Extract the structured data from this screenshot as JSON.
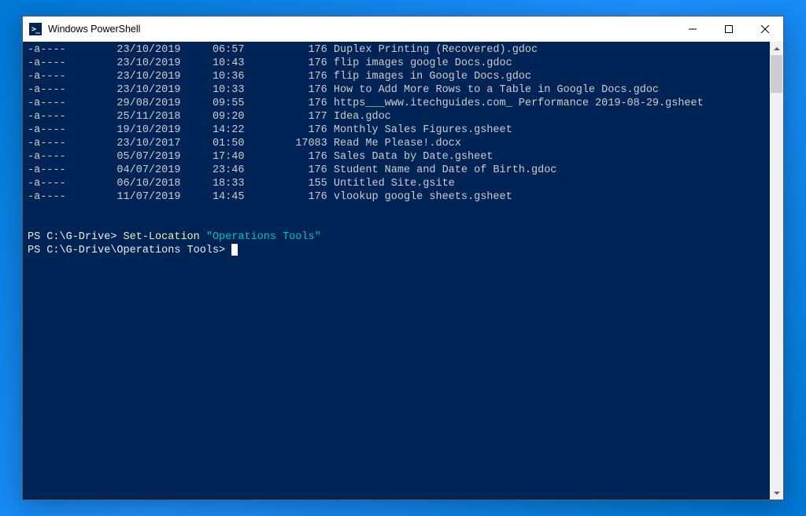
{
  "window": {
    "title": "Windows PowerShell"
  },
  "listing": {
    "rows": [
      {
        "mode": "-a----",
        "date": "23/10/2019",
        "time": "06:57",
        "length": "176",
        "name": "Duplex Printing (Recovered).gdoc"
      },
      {
        "mode": "-a----",
        "date": "23/10/2019",
        "time": "10:43",
        "length": "176",
        "name": "flip images google Docs.gdoc"
      },
      {
        "mode": "-a----",
        "date": "23/10/2019",
        "time": "10:36",
        "length": "176",
        "name": "flip images in Google Docs.gdoc"
      },
      {
        "mode": "-a----",
        "date": "23/10/2019",
        "time": "10:33",
        "length": "176",
        "name": "How to Add More Rows to a Table in Google Docs.gdoc"
      },
      {
        "mode": "-a----",
        "date": "29/08/2019",
        "time": "09:55",
        "length": "176",
        "name": "https___www.itechguides.com_ Performance 2019-08-29.gsheet"
      },
      {
        "mode": "-a----",
        "date": "25/11/2018",
        "time": "09:20",
        "length": "177",
        "name": "Idea.gdoc"
      },
      {
        "mode": "-a----",
        "date": "19/10/2019",
        "time": "14:22",
        "length": "176",
        "name": "Monthly Sales Figures.gsheet"
      },
      {
        "mode": "-a----",
        "date": "23/10/2017",
        "time": "01:50",
        "length": "17083",
        "name": "Read Me Please!.docx"
      },
      {
        "mode": "-a----",
        "date": "05/07/2019",
        "time": "17:40",
        "length": "176",
        "name": "Sales Data by Date.gsheet"
      },
      {
        "mode": "-a----",
        "date": "04/07/2019",
        "time": "23:46",
        "length": "176",
        "name": "Student Name and Date of Birth.gdoc"
      },
      {
        "mode": "-a----",
        "date": "06/10/2018",
        "time": "18:33",
        "length": "155",
        "name": "Untitled Site.gsite"
      },
      {
        "mode": "-a----",
        "date": "11/07/2019",
        "time": "14:45",
        "length": "176",
        "name": "vlookup google sheets.gsheet"
      }
    ]
  },
  "prompt1": {
    "prefix": "PS C:\\G-Drive> ",
    "cmd": "Set-Location",
    "arg": "\"Operations Tools\""
  },
  "prompt2": {
    "prefix": "PS C:\\G-Drive\\Operations Tools> "
  },
  "columns": {
    "mode_width": 14,
    "date_start": 14,
    "time_start": 29,
    "length_end": 47,
    "name_start": 48
  }
}
